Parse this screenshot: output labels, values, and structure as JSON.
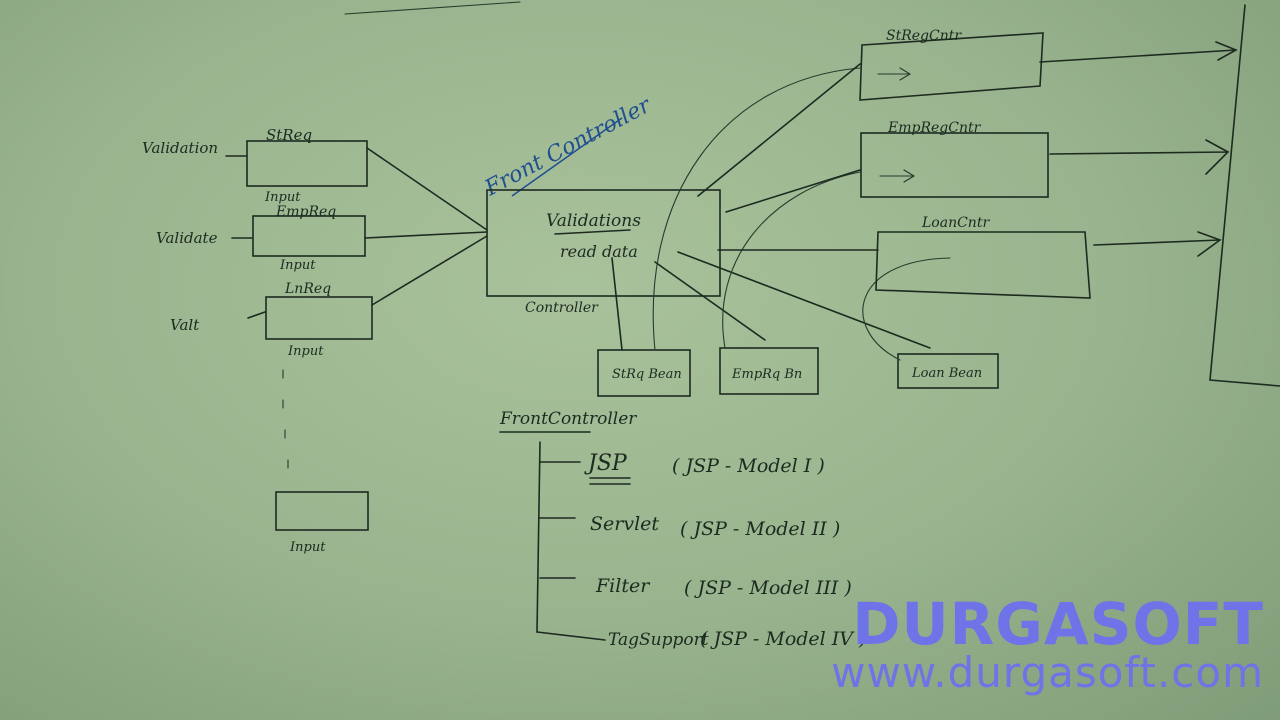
{
  "board": {
    "left_column": {
      "requests": [
        {
          "label": "StReq",
          "input": "Input",
          "validation": "Validation"
        },
        {
          "label": "EmpReq",
          "input": "Input",
          "validation": "Validate"
        },
        {
          "label": "LnReq",
          "input": "Input",
          "validation": "Valt"
        },
        {
          "label": "",
          "input": "Input",
          "validation": ""
        }
      ]
    },
    "front_controller": {
      "title": "Front Controller",
      "line1": "Validations",
      "line2": "read data",
      "caption": "Controller"
    },
    "beans": [
      "StRq Bean",
      "EmpRq Bn",
      "Loan Bean"
    ],
    "controllers": [
      "StRegCntr",
      "EmpRegCntr",
      "LoanCntr"
    ],
    "impl_list": {
      "heading": "FrontController",
      "items": [
        {
          "tech": "JSP",
          "model": "( JSP - Model I )"
        },
        {
          "tech": "Servlet",
          "model": "( JSP - Model II )"
        },
        {
          "tech": "Filter",
          "model": "( JSP - Model III )"
        },
        {
          "tech": "TagSupport",
          "model": "( JSP - Model IV )"
        }
      ]
    }
  },
  "watermark": {
    "brand": "DURGASOFT",
    "url": "www.durgasoft.com",
    "color": "#6f73e8"
  }
}
